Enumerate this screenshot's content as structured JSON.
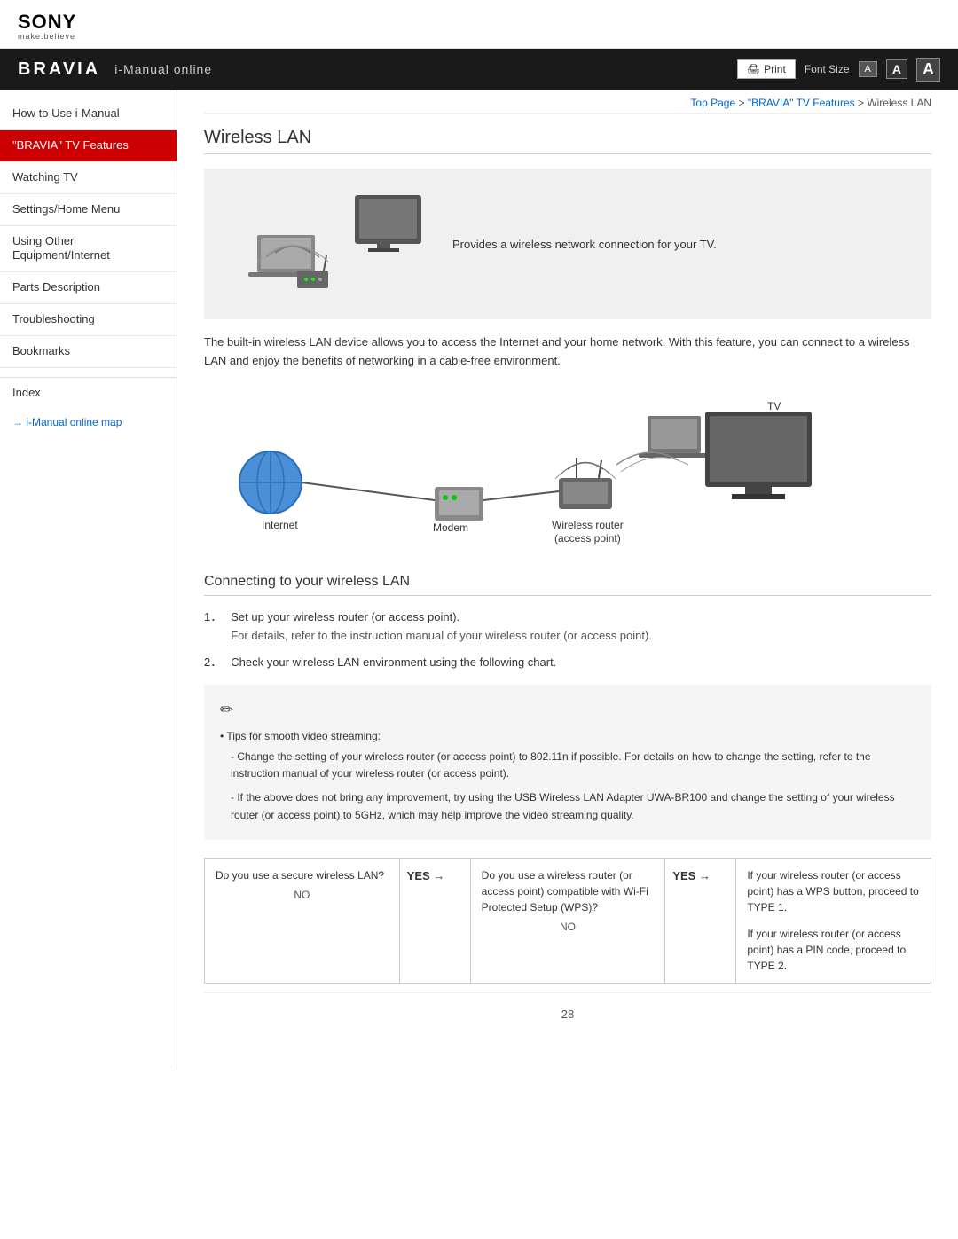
{
  "header": {
    "sony_logo": "SONY",
    "sony_tagline": "make.believe",
    "bravia_logo": "BRAVIA",
    "i_manual": "i-Manual online",
    "print_label": "Print",
    "font_size_label": "Font Size",
    "font_a_small": "A",
    "font_a_med": "A",
    "font_a_large": "A"
  },
  "breadcrumb": {
    "top_page": "Top Page",
    "separator1": " > ",
    "bravia_features": "\"BRAVIA\" TV Features",
    "separator2": " > ",
    "current": "Wireless LAN"
  },
  "sidebar": {
    "items": [
      {
        "label": "How to Use i-Manual",
        "active": false
      },
      {
        "label": "\"BRAVIA\" TV Features",
        "active": true
      },
      {
        "label": "Watching TV",
        "active": false
      },
      {
        "label": "Settings/Home Menu",
        "active": false
      },
      {
        "label": "Using Other Equipment/Internet",
        "active": false
      },
      {
        "label": "Parts Description",
        "active": false
      },
      {
        "label": "Troubleshooting",
        "active": false
      },
      {
        "label": "Bookmarks",
        "active": false
      }
    ],
    "index_label": "Index",
    "map_link": "i-Manual online map"
  },
  "content": {
    "page_title": "Wireless LAN",
    "diagram_text": "Provides a wireless network connection for your TV.",
    "body_text": "The built-in wireless LAN device allows you to access the Internet and your home network. With this feature, you can connect to a wireless LAN and enjoy the benefits of networking in a cable-free environment.",
    "network_labels": {
      "internet": "Internet",
      "modem": "Modem",
      "wireless_router": "Wireless router",
      "access_point": "(access point)",
      "tv": "TV"
    },
    "section_heading": "Connecting to your wireless LAN",
    "steps": [
      {
        "num": "1．",
        "main": "Set up your wireless router (or access point).",
        "sub": "For details, refer to the instruction manual of your wireless router (or access point)."
      },
      {
        "num": "2．",
        "main": "Check your wireless LAN environment using the following chart.",
        "sub": ""
      }
    ],
    "note": {
      "title": "Tips for smooth video streaming:",
      "lines": [
        "- Change the setting of your wireless router (or access point) to 802.11n if possible. For details on how to change the setting, refer to the instruction manual of your wireless router (or access point).",
        "- If the above does not bring any improvement, try using the USB Wireless LAN Adapter UWA-BR100 and change the setting of your wireless router (or access point) to 5GHz, which may help improve the video streaming quality."
      ]
    },
    "decision_table": {
      "col1": {
        "question": "Do you use a secure wireless LAN?",
        "no": "NO"
      },
      "arrow1": "YES →",
      "col2": {
        "question": "Do you use a wireless router (or access point) compatible with Wi-Fi Protected Setup (WPS)?",
        "no": "NO"
      },
      "arrow2": "YES →",
      "col3": {
        "type1_title": "If your wireless router (or access point) has a WPS button, proceed to TYPE 1.",
        "type2_title": "If your wireless router (or access point) has a PIN code, proceed to TYPE 2."
      }
    },
    "page_number": "28"
  }
}
